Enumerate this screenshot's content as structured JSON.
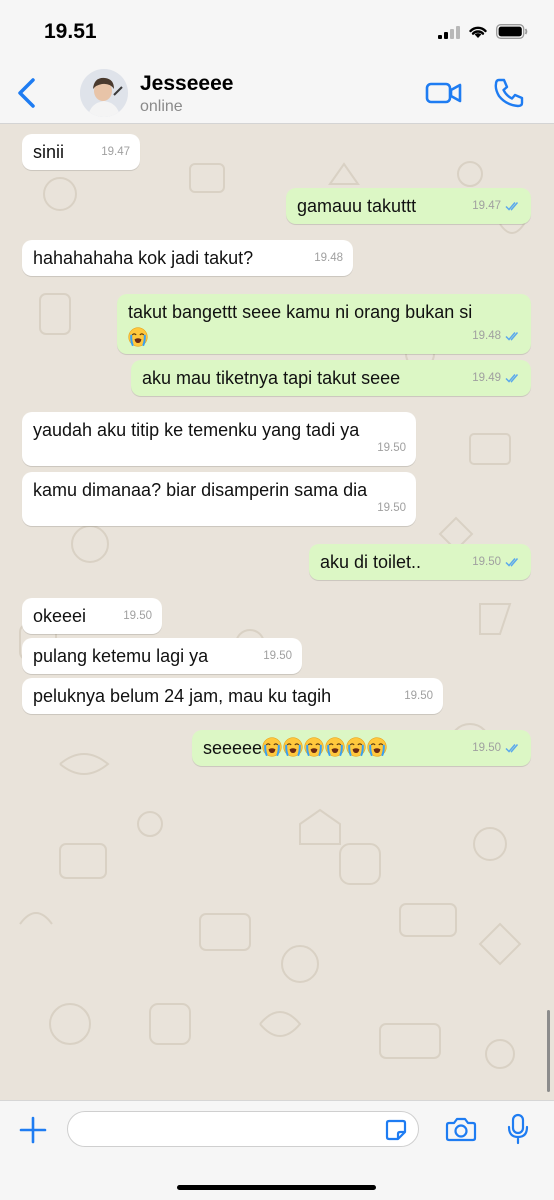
{
  "status_bar": {
    "time": "19.51"
  },
  "header": {
    "contact_name": "Jesseeee",
    "contact_status": "online"
  },
  "messages": [
    {
      "dir": "in",
      "text": "sinii",
      "time": "19.47"
    },
    {
      "dir": "out",
      "text": "gamauu takuttt",
      "time": "19.47"
    },
    {
      "dir": "in",
      "text": "hahahahaha kok jadi takut?",
      "time": "19.48"
    },
    {
      "dir": "out",
      "text": "takut bangettt seee kamu ni orang bukan si",
      "time": "19.48",
      "emoji_count": 1
    },
    {
      "dir": "out",
      "text": "aku mau tiketnya tapi takut seee",
      "time": "19.49"
    },
    {
      "dir": "in",
      "text": "yaudah aku titip ke temenku yang tadi ya",
      "time": "19.50"
    },
    {
      "dir": "in",
      "text": "kamu dimanaa? biar disamperin sama dia",
      "time": "19.50"
    },
    {
      "dir": "out",
      "text": "aku di toilet..",
      "time": "19.50"
    },
    {
      "dir": "in",
      "text": "okeeei",
      "time": "19.50"
    },
    {
      "dir": "in",
      "text": "pulang ketemu lagi ya",
      "time": "19.50"
    },
    {
      "dir": "in",
      "text": "peluknya belum 24 jam, mau ku tagih",
      "time": "19.50"
    },
    {
      "dir": "out",
      "text": "seeeee",
      "time": "19.50",
      "emoji_count": 6
    }
  ],
  "icons": {
    "back": "chevron-left-icon",
    "video": "video-camera-icon",
    "call": "phone-icon",
    "attach": "plus-icon",
    "sticker": "sticker-icon",
    "camera": "camera-icon",
    "mic": "microphone-icon",
    "read_receipt": "double-check-icon",
    "crying_emoji": "loudly-crying-face-emoji"
  },
  "input": {
    "value": "",
    "placeholder": ""
  },
  "colors": {
    "accent": "#1e7cf2",
    "outgoing_bubble": "#dcf7c5",
    "incoming_bubble": "#ffffff",
    "chat_background": "#e9e3da",
    "read_tick": "#5aa8ec"
  }
}
